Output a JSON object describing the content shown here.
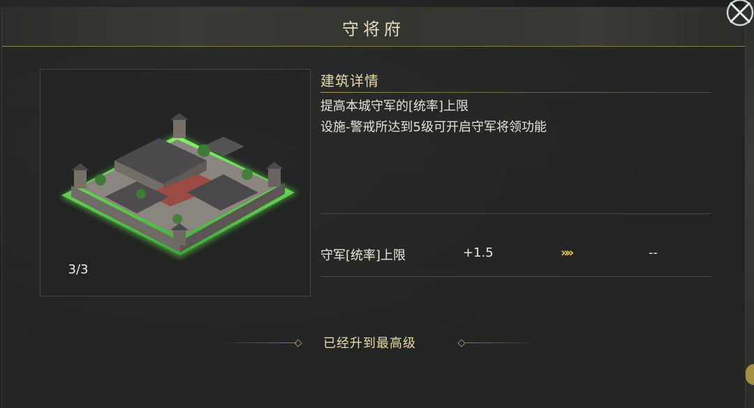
{
  "header": {
    "title": "守将府"
  },
  "building": {
    "level": "3/3"
  },
  "details": {
    "section_title": "建筑详情",
    "lines": [
      "提高本城守军的[统率]上限",
      "设施-警戒所达到5级可开启守军将领功能"
    ]
  },
  "stat": {
    "label": "守军[统率]上限",
    "current": "+1.5",
    "arrow": "»»",
    "next": "--"
  },
  "footer": {
    "maxed_text": "已经升到最高级"
  },
  "icons": {
    "close": "close-icon",
    "arrow": "upgrade-arrow-icon"
  },
  "colors": {
    "accent_gold": "#e8d8a8",
    "arrow_gold": "#e6c25a",
    "grass_glow": "#6ee05a"
  }
}
